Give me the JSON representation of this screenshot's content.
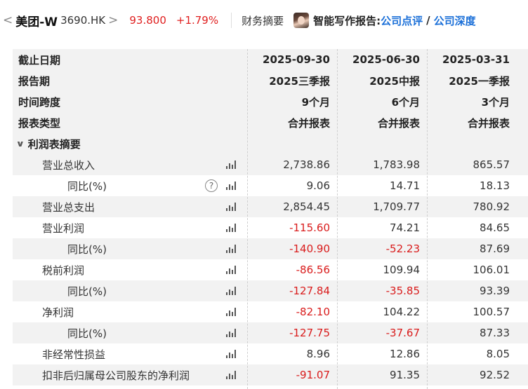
{
  "header": {
    "back_chevron": "<",
    "stock_name": "美团-W",
    "stock_code": "3690.HK",
    "forward_chevron": ">",
    "price": "93.800",
    "change": "+1.79%",
    "section": "财务摘要",
    "ai_label": "智能写作报告:",
    "link_1": "公司点评",
    "slash": "/",
    "link_2": "公司深度"
  },
  "table": {
    "header_rows": [
      {
        "label": "截止日期",
        "values": [
          "2025-09-30",
          "2025-06-30",
          "2025-03-31"
        ]
      },
      {
        "label": "报告期",
        "values": [
          "2025三季报",
          "2025中报",
          "2025一季报"
        ]
      },
      {
        "label": "时间跨度",
        "values": [
          "9个月",
          "6个月",
          "3个月"
        ]
      },
      {
        "label": "报表类型",
        "values": [
          "合并报表",
          "合并报表",
          "合并报表"
        ]
      }
    ],
    "section": {
      "toggle": "∨",
      "label": "利润表摘要"
    },
    "rows": [
      {
        "label": "营业总收入",
        "values": [
          "2,738.86",
          "1,783.98",
          "865.57"
        ]
      },
      {
        "label": "同比(%)",
        "help": "?",
        "values": [
          "9.06",
          "14.71",
          "18.13"
        ]
      },
      {
        "label": "营业总支出",
        "values": [
          "2,854.45",
          "1,709.77",
          "780.92"
        ]
      },
      {
        "label": "营业利润",
        "values": [
          "-115.60",
          "74.21",
          "84.65"
        ]
      },
      {
        "label": "同比(%)",
        "values": [
          "-140.90",
          "-52.23",
          "87.69"
        ]
      },
      {
        "label": "税前利润",
        "values": [
          "-86.56",
          "109.94",
          "106.01"
        ]
      },
      {
        "label": "同比(%)",
        "values": [
          "-127.84",
          "-35.85",
          "93.39"
        ]
      },
      {
        "label": "净利润",
        "values": [
          "-82.10",
          "104.22",
          "100.57"
        ]
      },
      {
        "label": "同比(%)",
        "values": [
          "-127.75",
          "-37.67",
          "87.33"
        ]
      },
      {
        "label": "非经常性损益",
        "values": [
          "8.96",
          "12.86",
          "8.05"
        ]
      },
      {
        "label": "扣非后归属母公司股东的净利润",
        "values": [
          "-91.07",
          "91.35",
          "92.52"
        ]
      }
    ]
  },
  "colors": {
    "up": "#e02020",
    "negative": "#d91b1b",
    "link": "#1a6fd8",
    "row_gray": "#f2f2f2"
  },
  "icons": {
    "chart": "bar-chart-icon",
    "help": "question-circle-icon",
    "avatar": "author-avatar"
  }
}
